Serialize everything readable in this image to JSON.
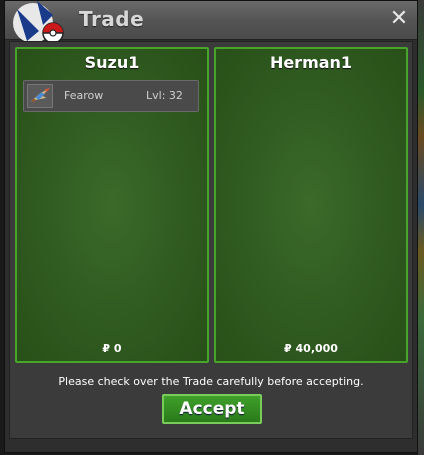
{
  "window": {
    "title": "Trade",
    "close_symbol": "✕"
  },
  "left_panel": {
    "player_name": "Suzu1",
    "pokemon": [
      {
        "name": "Fearow",
        "level": "Lvl: 32",
        "icon": "fearow-icon"
      }
    ],
    "money": "₽ 0"
  },
  "right_panel": {
    "player_name": "Herman1",
    "pokemon": [],
    "money": "₽ 40,000"
  },
  "notice": "Please check over the Trade carefully before accepting.",
  "accept_button": "Accept",
  "colors": {
    "panel_border": "#47a52c",
    "panel_fill": "#2f5a20",
    "button_fill": "#2a7a1a",
    "title_bar": "#555555"
  }
}
